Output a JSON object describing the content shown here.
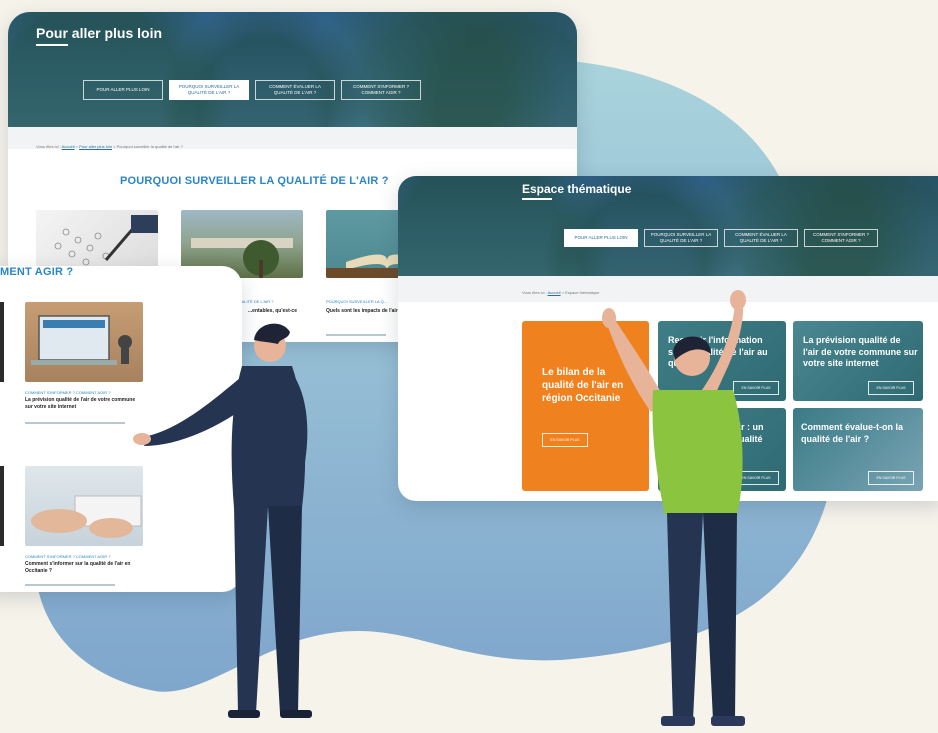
{
  "colors": {
    "background": "#f6f3ea",
    "blob_top": "#a9d3dc",
    "blob_bottom": "#7fa6cc",
    "orange": "#f0811f",
    "teal": "#3f7e86",
    "green_shirt": "#8bc53f",
    "navy_suit": "#253451"
  },
  "panel_back": {
    "hero_title": "Pour aller plus loin",
    "nav": [
      "POUR ALLER PLUS LOIN",
      "POURQUOI SURVEILLER LA QUALITÉ DE L'AIR ?",
      "COMMENT ÉVALUER LA QUALITÉ DE L'AIR ?",
      "COMMENT S'INFORMER ? COMMENT AGIR ?"
    ],
    "breadcrumb_prefix": "Vous êtes ici :",
    "breadcrumb_home": "Accueil",
    "breadcrumb_sep1": ">",
    "breadcrumb_mid": "Pour aller plus loin",
    "breadcrumb_sep2": ">",
    "breadcrumb_current": "Pourquoi surveiller la qualité de l'air ?",
    "section_title": "POURQUOI SURVEILLER LA QUALITÉ DE L'AIR ?",
    "cards": [
      {
        "tag": "POURQUOI SURVEILLER LA QUALITÉ DE L'AIR ?",
        "text": "...entables, qu'est-ce"
      },
      {
        "tag": "POURQUOI SURVEILLER LA Q...",
        "text": "Quels sont les impacts de l'air ?"
      }
    ]
  },
  "panel_left": {
    "section_title": "MENT AGIR ?",
    "cards": [
      {
        "tag": "COMMENT S'INFORMER ? COMMENT AGIR ?",
        "text": "La prévision qualité de l'air de votre commune sur votre site internet"
      },
      {
        "tag": "COMMENT S'INFORMER ? COMMENT AGIR ?",
        "text": "Comment s'informer sur la qualité de l'air en Occitanie ?"
      }
    ]
  },
  "panel_right": {
    "hero_title": "Espace thématique",
    "nav": [
      "POUR ALLER PLUS LOIN",
      "POURQUOI SURVEILLER LA QUALITÉ DE L'AIR ?",
      "COMMENT ÉVALUER LA QUALITÉ DE L'AIR ?",
      "COMMENT S'INFORMER ? COMMENT AGIR ?"
    ],
    "breadcrumb_prefix": "Vous êtes ici :",
    "breadcrumb_home": "Accueil",
    "breadcrumb_sep": ">",
    "breadcrumb_current": "Espace thématique",
    "tiles": [
      {
        "title": "Le bilan de la qualité de l'air en région Occitanie",
        "button": "EN SAVOIR PLUS"
      },
      {
        "title": "Recevoir l'information sur la qualité de l'air au quotidien",
        "button": "EN SAVOIR PLUS"
      },
      {
        "title": "La prévision qualité de l'air de votre commune sur votre site internet",
        "button": "EN SAVOIR PLUS"
      },
      {
        "title": "...air : un ...qualité",
        "button": "EN SAVOIR PLUS"
      },
      {
        "title": "Comment évalue-t-on la qualité de l'air ?",
        "button": "EN SAVOIR PLUS"
      }
    ]
  }
}
